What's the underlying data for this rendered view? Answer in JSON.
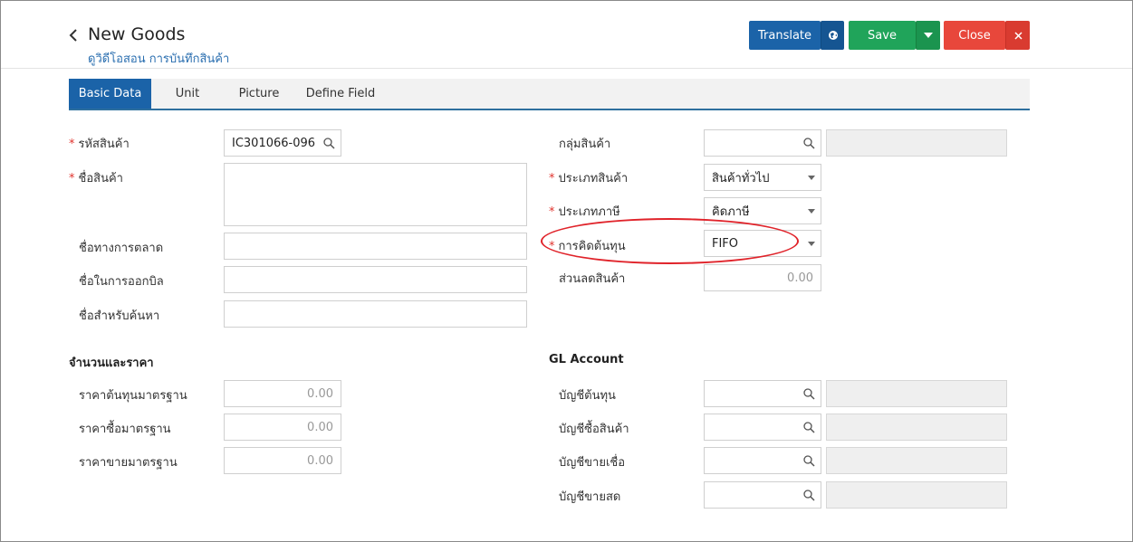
{
  "header": {
    "title": "New Goods",
    "subtitle": "ดูวิดีโอสอน การบันทึกสินค้า"
  },
  "toolbar": {
    "translate_label": "Translate",
    "save_label": "Save",
    "close_label": "Close"
  },
  "tabs": [
    {
      "label": "Basic Data",
      "active": true
    },
    {
      "label": "Unit",
      "active": false
    },
    {
      "label": "Picture",
      "active": false
    },
    {
      "label": "Define Field",
      "active": false
    }
  ],
  "left_form": {
    "product_code": {
      "label": "รหัสสินค้า",
      "required": true,
      "value": "IC301066-096"
    },
    "product_name": {
      "label": "ชื่อสินค้า",
      "required": true,
      "value": ""
    },
    "marketing_name": {
      "label": "ชื่อทางการตลาด",
      "value": ""
    },
    "billing_name": {
      "label": "ชื่อในการออกบิล",
      "value": ""
    },
    "search_name": {
      "label": "ชื่อสำหรับค้นหา",
      "value": ""
    }
  },
  "right_form": {
    "product_group": {
      "label": "กลุ่มสินค้า",
      "value": ""
    },
    "product_type": {
      "label": "ประเภทสินค้า",
      "required": true,
      "value": "สินค้าทั่วไป"
    },
    "tax_type": {
      "label": "ประเภทภาษี",
      "required": true,
      "value": "คิดภาษี"
    },
    "costing_method": {
      "label": "การคิดต้นทุน",
      "required": true,
      "value": "FIFO"
    },
    "discount": {
      "label": "ส่วนลดสินค้า",
      "value": "0.00"
    }
  },
  "pricing": {
    "title": "จำนวนและราคา",
    "standard_cost": {
      "label": "ราคาต้นทุนมาตรฐาน",
      "value": "0.00"
    },
    "standard_buy": {
      "label": "ราคาซื้อมาตรฐาน",
      "value": "0.00"
    },
    "standard_sell": {
      "label": "ราคาขายมาตรฐาน",
      "value": "0.00"
    }
  },
  "gl_account": {
    "title": "GL Account",
    "cost_account": {
      "label": "บัญชีต้นทุน",
      "value": ""
    },
    "purchase_account": {
      "label": "บัญชีซื้อสินค้า",
      "value": ""
    },
    "credit_sales_account": {
      "label": "บัญชีขายเชื่อ",
      "value": ""
    },
    "cash_sales_account": {
      "label": "บัญชีขายสด",
      "value": ""
    }
  },
  "colors": {
    "primary": "#1b63a8",
    "save": "#20a45a",
    "close": "#e8473b",
    "required": "#e0332e",
    "highlight": "#e0232a"
  }
}
